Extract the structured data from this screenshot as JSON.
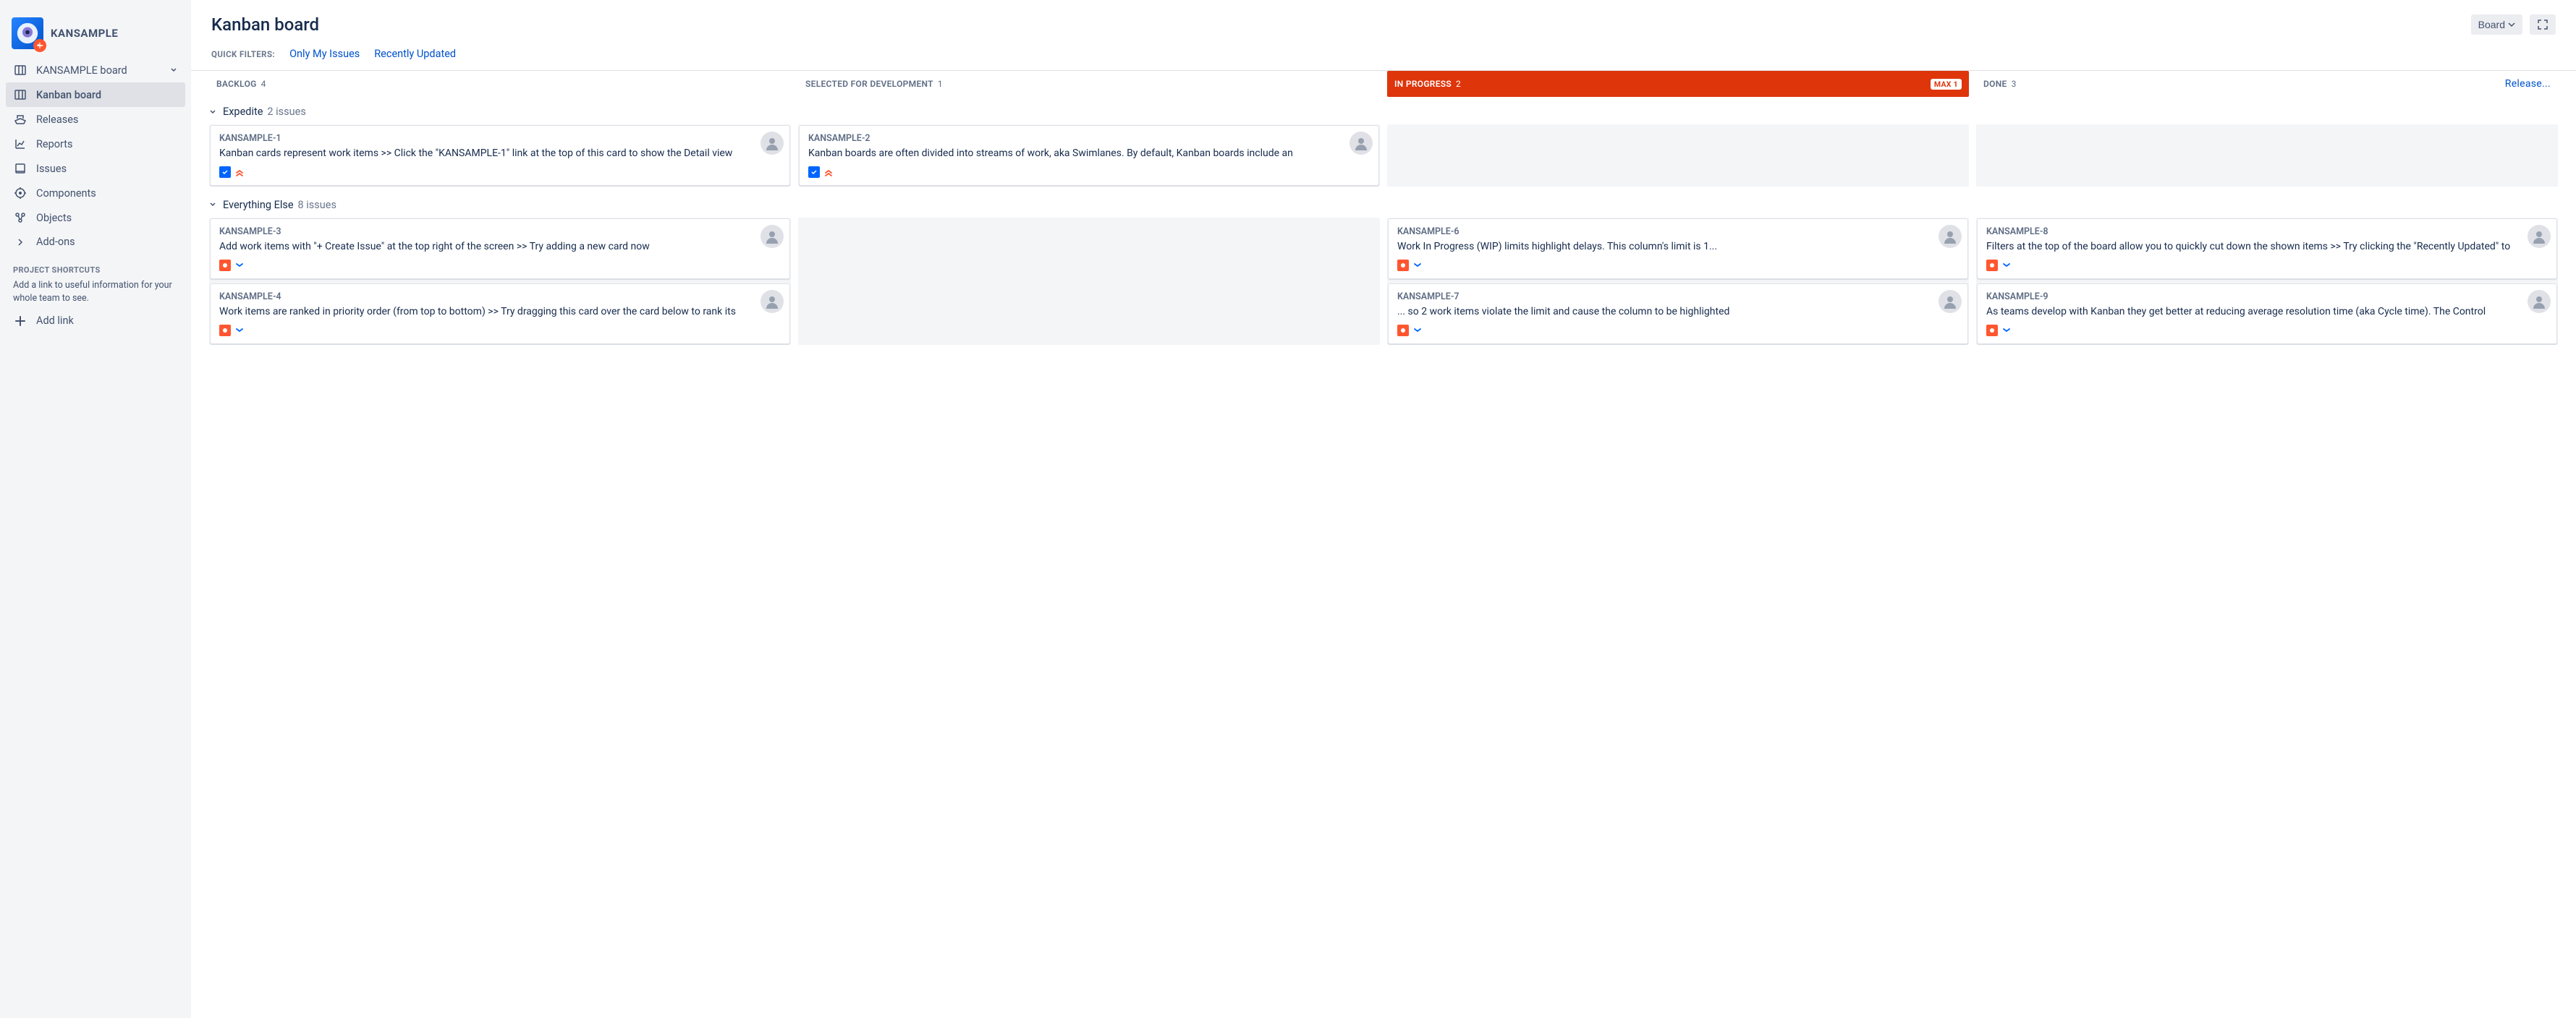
{
  "project": {
    "name": "KANSAMPLE"
  },
  "sidebar": {
    "items": [
      {
        "label": "KANSAMPLE board",
        "icon": "board",
        "expandable": true
      },
      {
        "label": "Kanban board",
        "icon": "board",
        "selected": true
      },
      {
        "label": "Releases",
        "icon": "ship"
      },
      {
        "label": "Reports",
        "icon": "chart"
      },
      {
        "label": "Issues",
        "icon": "issues"
      },
      {
        "label": "Components",
        "icon": "component"
      },
      {
        "label": "Objects",
        "icon": "objects"
      },
      {
        "label": "Add-ons",
        "icon": "chevron-right"
      }
    ],
    "shortcuts": {
      "title": "PROJECT SHORTCUTS",
      "desc": "Add a link to useful information for your whole team to see.",
      "add_link_label": "Add link"
    }
  },
  "header": {
    "title": "Kanban board",
    "board_btn": "Board",
    "filters_label": "QUICK FILTERS:",
    "filters": [
      "Only My Issues",
      "Recently Updated"
    ]
  },
  "columns": [
    {
      "name": "BACKLOG",
      "count": 4
    },
    {
      "name": "SELECTED FOR DEVELOPMENT",
      "count": 1
    },
    {
      "name": "IN PROGRESS",
      "count": 2,
      "over": true,
      "max": "MAX 1"
    },
    {
      "name": "DONE",
      "count": 3,
      "release": "Release..."
    }
  ],
  "swimlanes": [
    {
      "name": "Expedite",
      "count": "2 issues",
      "cols": [
        [
          {
            "key": "KANSAMPLE-1",
            "summary": "Kanban cards represent work items >> Click the \"KANSAMPLE-1\" link at the top of this card to show the Detail view",
            "type": "task",
            "priority": "highest"
          }
        ],
        [
          {
            "key": "KANSAMPLE-2",
            "summary": "Kanban boards are often divided into streams of work, aka Swimlanes. By default, Kanban boards include an",
            "type": "task",
            "priority": "highest"
          }
        ],
        [],
        []
      ]
    },
    {
      "name": "Everything Else",
      "count": "8 issues",
      "cols": [
        [
          {
            "key": "KANSAMPLE-3",
            "summary": "Add work items with \"+ Create Issue\" at the top right of the screen >> Try adding a new card now",
            "type": "story",
            "priority": "low"
          },
          {
            "key": "KANSAMPLE-4",
            "summary": "Work items are ranked in priority order (from top to bottom) >> Try dragging this card over the card below to rank its",
            "type": "story",
            "priority": "low"
          }
        ],
        [],
        [
          {
            "key": "KANSAMPLE-6",
            "summary": "Work In Progress (WIP) limits highlight delays. This column's limit is 1...",
            "type": "story",
            "priority": "low"
          },
          {
            "key": "KANSAMPLE-7",
            "summary": "... so 2 work items violate the limit and cause the column to be highlighted",
            "type": "story",
            "priority": "low"
          }
        ],
        [
          {
            "key": "KANSAMPLE-8",
            "summary": "Filters at the top of the board allow you to quickly cut down the shown items >> Try clicking the \"Recently Updated\" to",
            "type": "story",
            "priority": "low"
          },
          {
            "key": "KANSAMPLE-9",
            "summary": "As teams develop with Kanban they get better at reducing average resolution time (aka Cycle time). The Control",
            "type": "story",
            "priority": "low"
          }
        ]
      ]
    }
  ]
}
